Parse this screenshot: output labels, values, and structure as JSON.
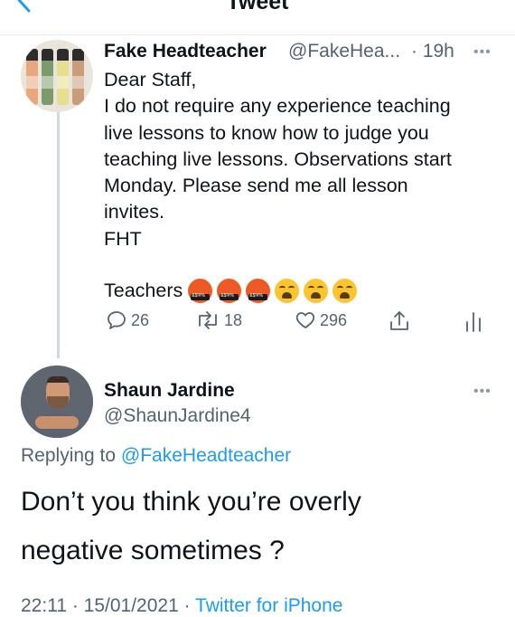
{
  "nav": {
    "title": "Tweet"
  },
  "tweet": {
    "name": "Fake Headteacher",
    "handle": "@FakeHea...",
    "time": "· 19h",
    "more": "•••",
    "lines": [
      "Dear Staff,",
      "I do not require any experience teaching",
      "live lessons to know how to judge you",
      "teaching live lessons. Observations start",
      "Monday. Please send me all lesson",
      "invites.",
      "FHT"
    ],
    "emoji_label": "Teachers",
    "emoji": [
      "angry-face-symbols",
      "angry-face-symbols",
      "angry-face-symbols",
      "weary-face",
      "weary-face",
      "weary-face"
    ],
    "replies": "26",
    "retweets": "18",
    "likes": "296"
  },
  "reply": {
    "name": "Shaun Jardine",
    "handle": "@ShaunJardine4",
    "more": "•••",
    "replying_prefix": "Replying to ",
    "replying_to": "@FakeHeadteacher",
    "lines": [
      "Don’t you think you’re overly",
      "negative sometimes ?"
    ],
    "timestamp": "22:11 · 15/01/2021 · ",
    "source": "Twitter for iPhone"
  },
  "colors": {
    "accent": "#1d9bf0",
    "muted": "#536471",
    "line": "#cfd9de"
  }
}
